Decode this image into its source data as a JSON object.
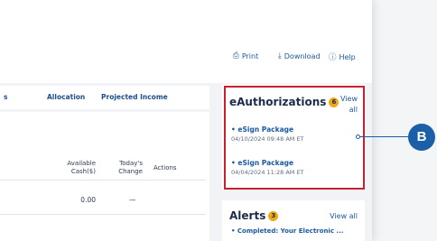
{
  "toolbar": {
    "print": "Print",
    "download": "Download",
    "help": "Help",
    "icons": [
      "printer-icon",
      "download-icon",
      "help-icon"
    ]
  },
  "tabs": [
    {
      "label": "s"
    },
    {
      "label": "Allocation"
    },
    {
      "label": "Projected Income"
    }
  ],
  "table": {
    "columns": [
      "Available Cash($)",
      "Today's Change",
      "Actions"
    ],
    "col_available_line1": "Available",
    "col_available_line2": "Cash($)",
    "col_change_line1": "Today's",
    "col_change_line2": "Change",
    "col_actions": "Actions",
    "rows": [
      {
        "available_cash": "0.00",
        "todays_change": "—"
      }
    ]
  },
  "eauthorizations": {
    "title": "eAuthorizations",
    "count": "6",
    "view_all_line1": "View",
    "view_all_line2": "all",
    "items": [
      {
        "label": "• eSign Package",
        "date": "04/10/2024 09:48 AM ET"
      },
      {
        "label": "• eSign Package",
        "date": "04/04/2024 11:28 AM ET"
      }
    ]
  },
  "alerts": {
    "title": "Alerts",
    "count": "3",
    "view_all": "View all",
    "items": [
      {
        "label": "• Completed: Your Electronic ..."
      }
    ]
  },
  "callout": {
    "label": "B"
  },
  "colors": {
    "link": "#1c5aa3",
    "highlight": "#c8202e",
    "badge": "#f0a818",
    "callout": "#1a5fa8"
  }
}
